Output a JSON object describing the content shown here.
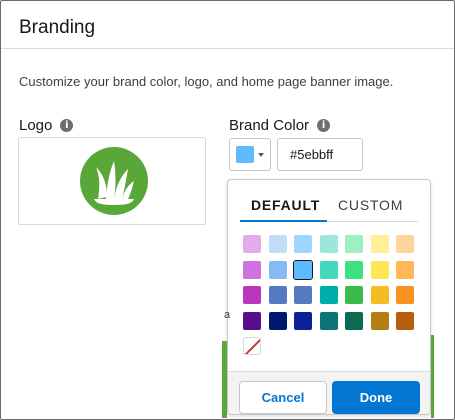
{
  "page": {
    "title": "Branding",
    "description": "Customize your brand color, logo, and home page banner image."
  },
  "logo": {
    "label": "Logo",
    "info_glyph": "i",
    "image_color": "#5aa739"
  },
  "brand_color": {
    "label": "Brand Color",
    "info_glyph": "i",
    "selected_color": "#5ebbff",
    "hex_value": "#5ebbff"
  },
  "picker": {
    "tabs": [
      {
        "label": "DEFAULT",
        "active": true
      },
      {
        "label": "CUSTOM",
        "active": false
      }
    ],
    "swatches": [
      [
        "#e3abec",
        "#c2dbf7",
        "#9fd6ff",
        "#9de7da",
        "#9df0c0",
        "#fff099",
        "#fed49a"
      ],
      [
        "#d073e0",
        "#86baf3",
        "#5ebbff",
        "#44d8be",
        "#3be282",
        "#ffe654",
        "#ffb758"
      ],
      [
        "#bd35bd",
        "#5779c1",
        "#5679c0",
        "#00aea9",
        "#3cba4c",
        "#f5bc25",
        "#f99221"
      ],
      [
        "#580d8c",
        "#001970",
        "#0a2399",
        "#0b7477",
        "#0b6b50",
        "#b67e11",
        "#b85d0d"
      ]
    ],
    "selected_swatch": "#5ebbff",
    "cancel_label": "Cancel",
    "done_label": "Done"
  },
  "partial_text": "a"
}
